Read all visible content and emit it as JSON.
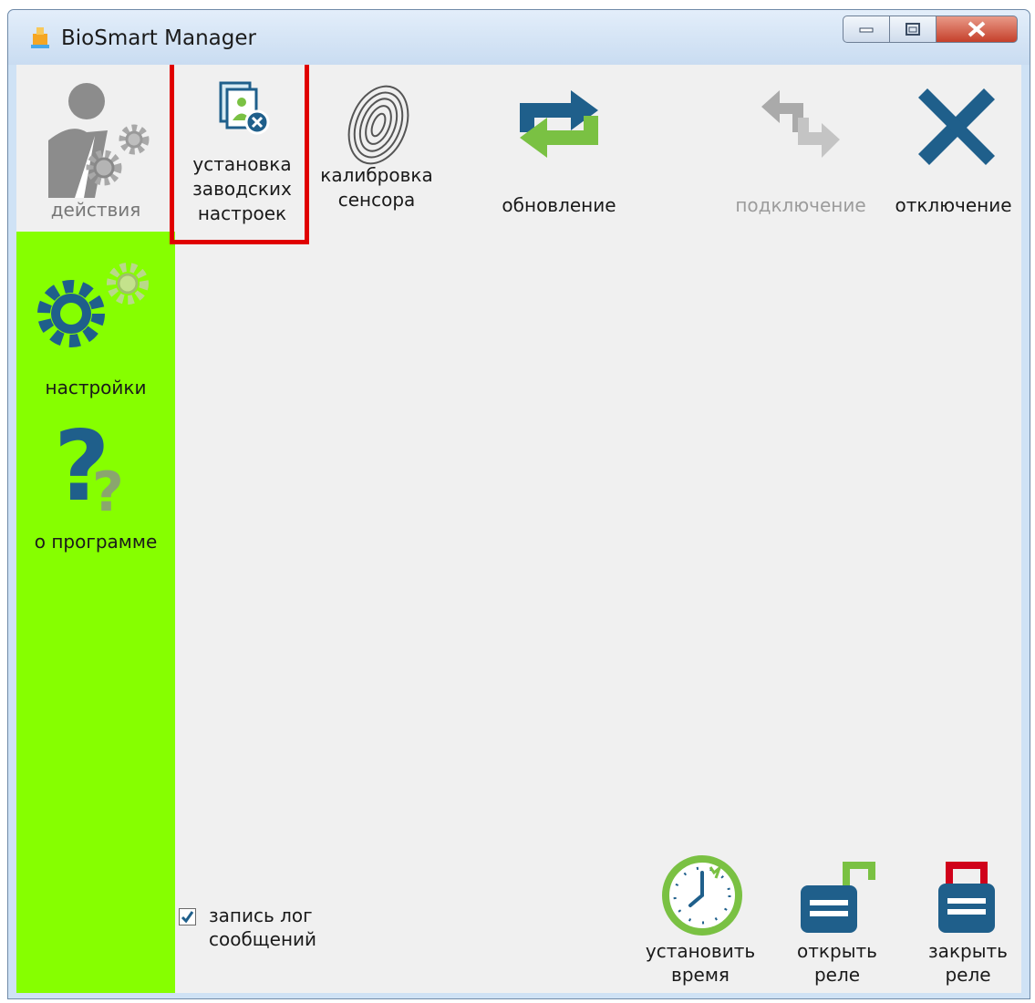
{
  "window": {
    "title": "BioSmart Manager",
    "controls": {
      "minimize": "minimize-icon",
      "maximize": "maximize-icon",
      "close": "close-icon"
    }
  },
  "sidebar": {
    "items": [
      {
        "label": "действия",
        "icon": "user-gears-icon"
      },
      {
        "label": "настройки",
        "icon": "gear-icon"
      },
      {
        "label": "о программе",
        "icon": "question-icon"
      }
    ],
    "active_color": "#86FF00"
  },
  "toolbar": {
    "factory_reset": {
      "line1": "установка",
      "line2": "заводских",
      "line3": "настроек"
    },
    "calibrate": {
      "line1": "калибровка",
      "line2": "сенсора"
    },
    "update": "обновление",
    "connect": "подключение",
    "disconnect": "отключение"
  },
  "bottom": {
    "log_checkbox": {
      "checked": true,
      "line1": "запись лог",
      "line2": "сообщений"
    },
    "set_time": {
      "line1": "установить",
      "line2": "время"
    },
    "open_relay": {
      "line1": "открыть",
      "line2": "реле"
    },
    "close_relay": {
      "line1": "закрыть",
      "line2": "реле"
    }
  },
  "colors": {
    "brand_blue": "#1f5f8b",
    "brand_green": "#7ac143",
    "highlight_red": "#E00000",
    "close_red": "#d0021b"
  }
}
